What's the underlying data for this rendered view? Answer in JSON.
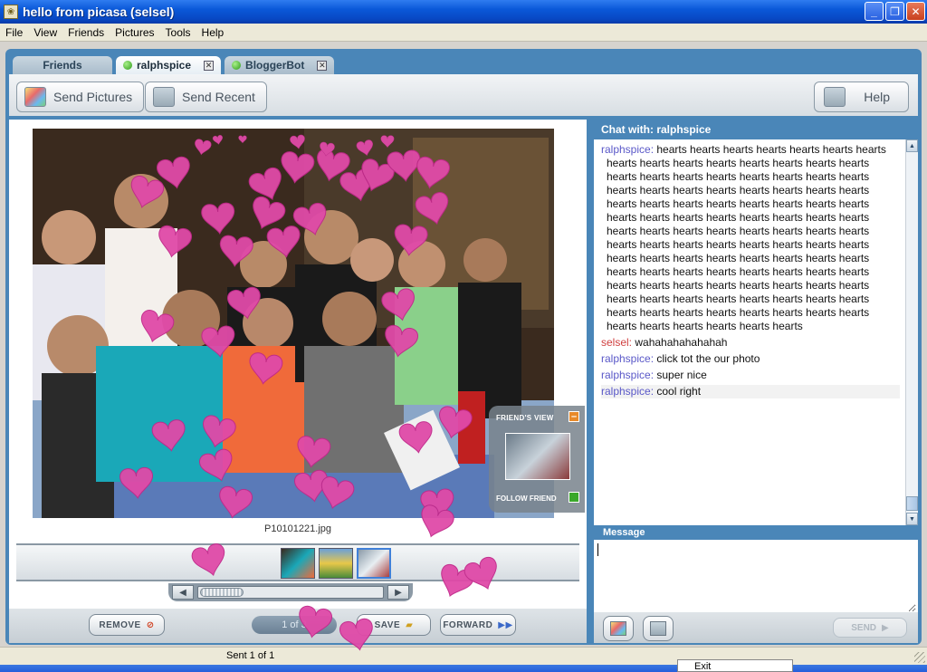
{
  "window": {
    "title": "hello from picasa (selsel)",
    "minimize": "_",
    "maximize": "❐",
    "close": "✕"
  },
  "menu": [
    "File",
    "View",
    "Friends",
    "Pictures",
    "Tools",
    "Help"
  ],
  "tabs": [
    {
      "label": "Friends",
      "status": ""
    },
    {
      "label": "ralphspice",
      "status": "online"
    },
    {
      "label": "BloggerBot",
      "status": "online"
    }
  ],
  "toolbar": {
    "send_pictures": "Send Pictures",
    "send_recent": "Send Recent",
    "help": "Help"
  },
  "viewer": {
    "filename": "P10101221.jpg",
    "pager": "1 of 3",
    "remove": "REMOVE",
    "save": "SAVE",
    "forward": "FORWARD",
    "friends_view": "FRIEND'S VIEW",
    "follow_friend": "FOLLOW FRIEND"
  },
  "chat": {
    "header": "Chat with: ralphspice",
    "messages": [
      {
        "who": "ralphspice:",
        "text": "hearts hearts hearts hearts hearts hearts hearts hearts hearts hearts hearts hearts hearts hearts hearts hearts hearts hearts hearts hearts hearts hearts hearts hearts hearts hearts hearts hearts hearts hearts hearts hearts hearts hearts hearts hearts hearts hearts hearts hearts hearts hearts hearts hearts hearts hearts hearts hearts hearts hearts hearts hearts hearts hearts hearts hearts hearts hearts hearts hearts hearts hearts hearts hearts hearts hearts hearts hearts hearts hearts hearts hearts hearts hearts hearts hearts hearts hearts hearts hearts hearts hearts hearts hearts hearts hearts hearts hearts hearts hearts hearts hearts hearts hearts hearts hearts hearts hearts hearts hearts hearts hearts hearts hearts hearts hearts hearts hearts hearts",
        "self": false
      },
      {
        "who": "selsel:",
        "text": "wahahahahahahah",
        "self": true
      },
      {
        "who": "ralphspice:",
        "text": "click tot the our photo",
        "self": false
      },
      {
        "who": "ralphspice:",
        "text": "super nice",
        "self": false
      },
      {
        "who": "ralphspice:",
        "text": "cool right",
        "self": false
      }
    ],
    "message_label": "Message",
    "send": "SEND"
  },
  "status": {
    "text": "Sent 1 of 1"
  },
  "popup": {
    "exit": "Exit"
  },
  "colors": {
    "accent": "#4a86b8",
    "heart": "#e04aa8",
    "online": "#2d9a18"
  }
}
